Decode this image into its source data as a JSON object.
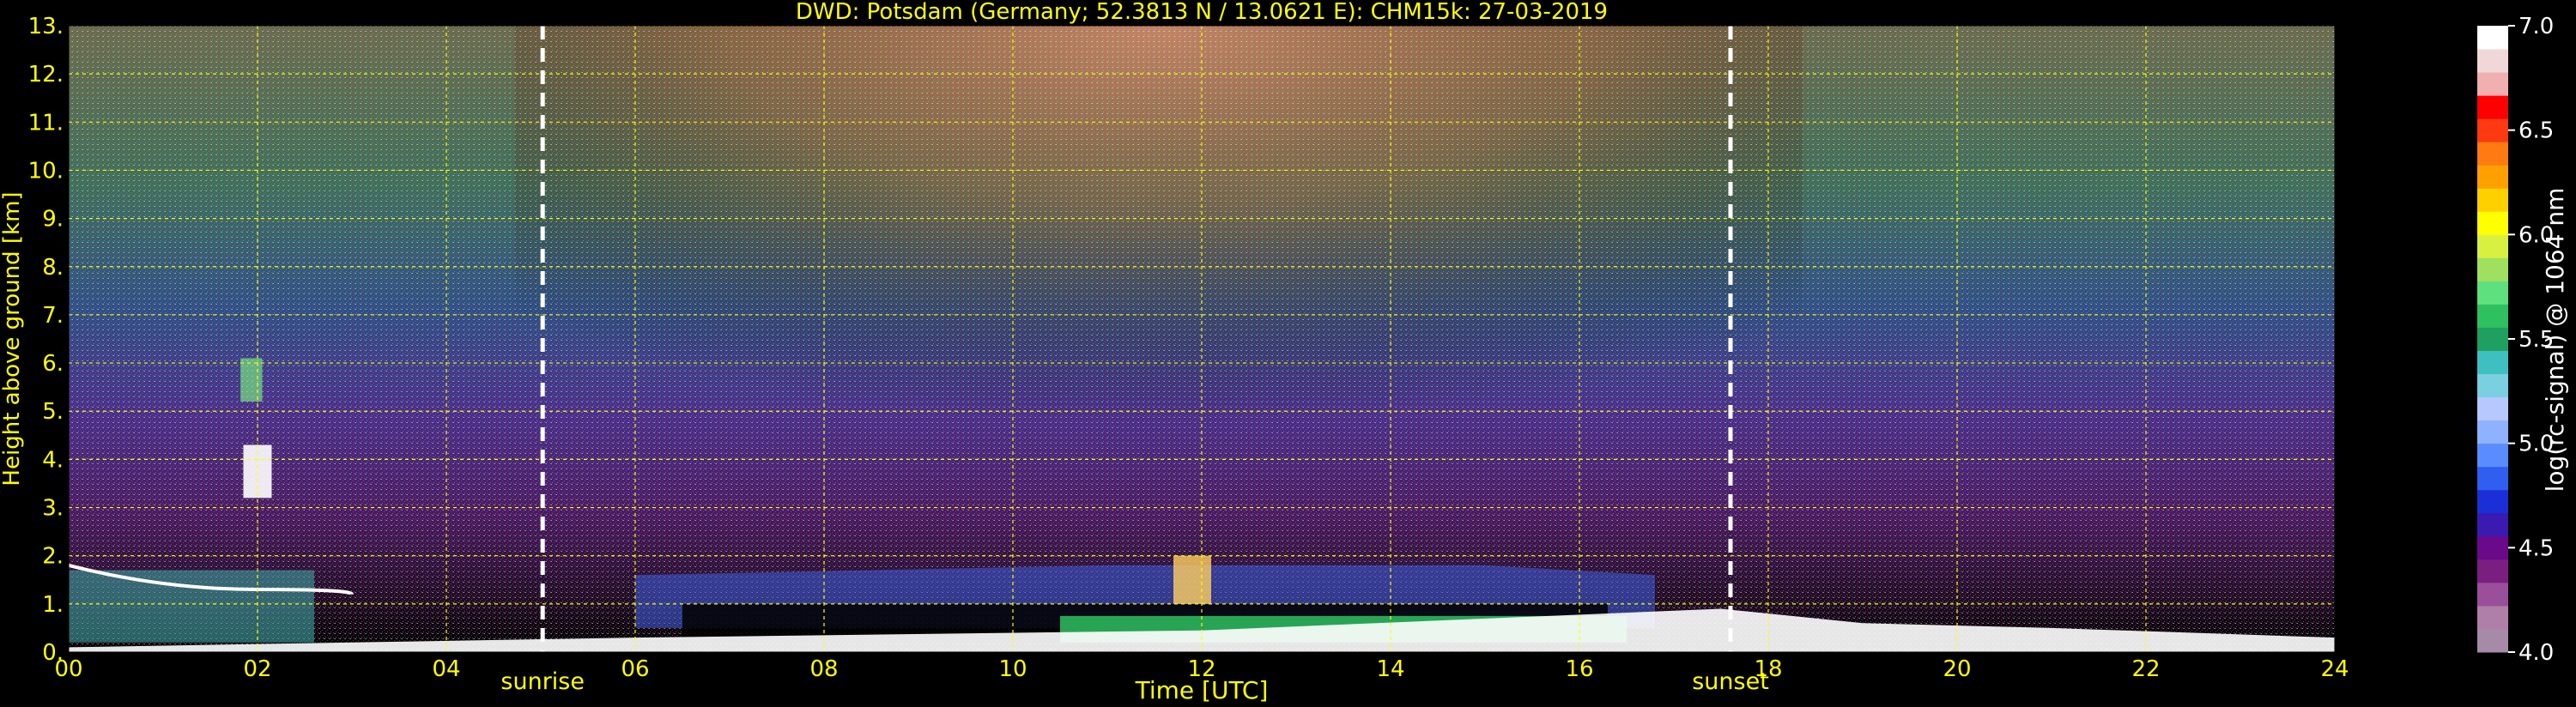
{
  "chart_data": {
    "type": "heatmap",
    "title": "DWD: Potsdam (Germany; 52.3813 N / 13.0621 E):    CHM15k: 27-03-2019",
    "xlabel": "Time [UTC]",
    "ylabel": "Height above ground [km]",
    "colorbar_label": "log(rc-signal) @ 1064 nm",
    "xlim": [
      0,
      24
    ],
    "ylim": [
      0,
      13
    ],
    "x_ticks": [
      "00",
      "02",
      "04",
      "06",
      "08",
      "10",
      "12",
      "14",
      "16",
      "18",
      "20",
      "22",
      "24"
    ],
    "y_ticks": [
      "0.",
      "1.",
      "2.",
      "3.",
      "4.",
      "5.",
      "6.",
      "7.",
      "8.",
      "9.",
      "10.",
      "11.",
      "12.",
      "13."
    ],
    "colorbar_range": [
      4.0,
      7.0
    ],
    "colorbar_ticks": [
      "4.0",
      "4.5",
      "5.0",
      "5.5",
      "6.0",
      "6.5",
      "7.0"
    ],
    "grid": true,
    "markers": [
      {
        "label": "sunrise",
        "time_utc": 5.02
      },
      {
        "label": "sunset",
        "time_utc": 17.6
      }
    ],
    "colors": {
      "text": "#ffff00",
      "grid": "#ffff00",
      "marker": "#ffffff",
      "background": "#000000"
    },
    "colormap": [
      "#a58ba8",
      "#b07fa8",
      "#9a4f9a",
      "#7a1f80",
      "#6a0a8a",
      "#3a1ab0",
      "#1a2fd8",
      "#2f5ef0",
      "#5a8cff",
      "#8fb2ff",
      "#b6c8ff",
      "#7ad0e0",
      "#3fc0c0",
      "#1f9f60",
      "#2fc060",
      "#5fe07f",
      "#9fe05f",
      "#d8f040",
      "#ffff00",
      "#ffd000",
      "#ffa000",
      "#ff7a10",
      "#ff3a10",
      "#ff0000",
      "#f0b0b0",
      "#f0d8d8",
      "#ffffff"
    ]
  }
}
